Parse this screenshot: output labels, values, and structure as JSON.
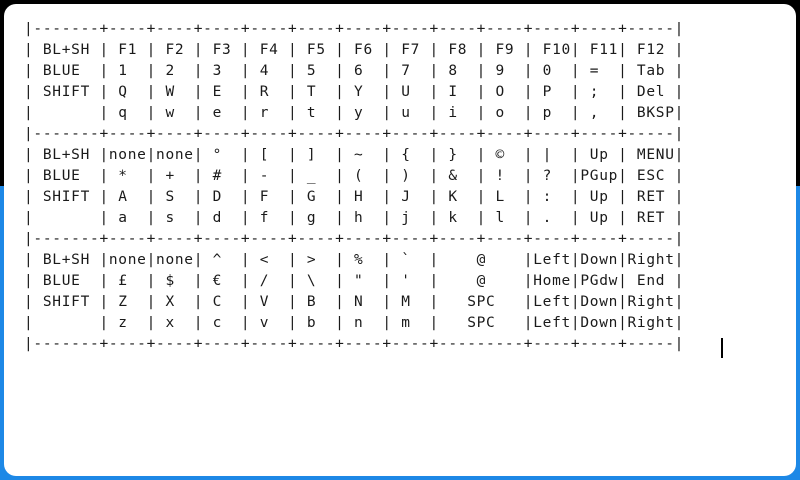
{
  "keymap_text": "|-------+----+----+----+----+----+----+----+----+----+----+----+-----|\n| BL+SH | F1 | F2 | F3 | F4 | F5 | F6 | F7 | F8 | F9 | F10| F11| F12 |\n| BLUE  | 1  | 2  | 3  | 4  | 5  | 6  | 7  | 8  | 9  | 0  | =  | Tab |\n| SHIFT | Q  | W  | E  | R  | T  | Y  | U  | I  | O  | P  | ;  | Del |\n|       | q  | w  | e  | r  | t  | y  | u  | i  | o  | p  | ,  | BKSP|\n|-------+----+----+----+----+----+----+----+----+----+----+----+-----|\n| BL+SH |none|none| °  | [  | ]  | ~  | {  | }  | ©  | |  | Up | MENU|\n| BLUE  | *  | +  | #  | -  | _  | (  | )  | &  | !  | ?  |PGup| ESC |\n| SHIFT | A  | S  | D  | F  | G  | H  | J  | K  | L  | :  | Up | RET |\n|       | a  | s  | d  | f  | g  | h  | j  | k  | l  | .  | Up | RET |\n|-------+----+----+----+----+----+----+----+----+----+----+----+-----|\n| BL+SH |none|none| ^  | <  | >  | %  | `  |    @    |Left|Down|Right|\n| BLUE  | £  | $  | €  | /  | \\  | \"  | '  |    @    |Home|PGdw| End |\n| SHIFT | Z  | X  | C  | V  | B  | N  | M  |   SPC   |Left|Down|Right|\n|       | z  | x  | c  | v  | b  | n  | m  |   SPC   |Left|Down|Right|\n|-------+----+----+----+----+----+----+----+---------+----+----+-----|",
  "colors": {
    "background_blue": "#1d88e6",
    "background_top_band": "#000000",
    "screen": "#ffffff",
    "text": "#1a1a1a"
  }
}
